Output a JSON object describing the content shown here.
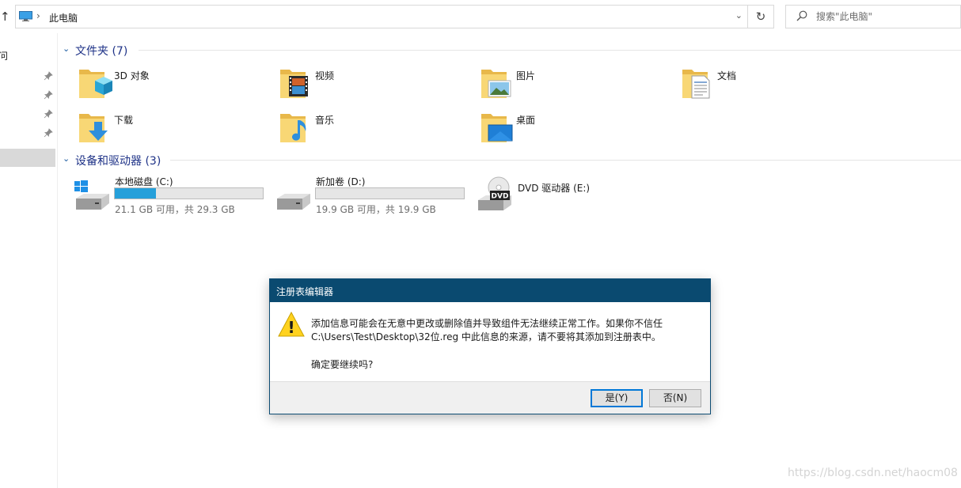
{
  "address_bar": {
    "up_glyph": "↑",
    "separator": "›",
    "location": "此电脑",
    "dropdown_glyph": "⌄",
    "refresh_glyph": "↻"
  },
  "search": {
    "placeholder": "搜索\"此电脑\""
  },
  "nav_pane": {
    "partial_text": "问"
  },
  "folders_group": {
    "label": "文件夹 (7)",
    "items": [
      {
        "label": "3D 对象",
        "icon": "3d-objects-folder-icon"
      },
      {
        "label": "视频",
        "icon": "videos-folder-icon"
      },
      {
        "label": "图片",
        "icon": "pictures-folder-icon"
      },
      {
        "label": "文档",
        "icon": "documents-folder-icon"
      },
      {
        "label": "下载",
        "icon": "downloads-folder-icon"
      },
      {
        "label": "音乐",
        "icon": "music-folder-icon"
      },
      {
        "label": "桌面",
        "icon": "desktop-folder-icon"
      }
    ]
  },
  "devices_group": {
    "label": "设备和驱动器 (3)",
    "drives": [
      {
        "name": "本地磁盘 (C:)",
        "size_text": "21.1 GB 可用，共 29.3 GB",
        "used_fraction": 0.28
      },
      {
        "name": "新加卷 (D:)",
        "size_text": "19.9 GB 可用，共 19.9 GB",
        "used_fraction": 0.0
      },
      {
        "name": "DVD 驱动器 (E:)",
        "dvd_label": "DVD"
      }
    ]
  },
  "dialog": {
    "title": "注册表编辑器",
    "message_line1": "添加信息可能会在无意中更改或删除值并导致组件无法继续正常工作。如果你不信任",
    "message_line2": "C:\\Users\\Test\\Desktop\\32位.reg 中此信息的来源，请不要将其添加到注册表中。",
    "question": "确定要继续吗?",
    "yes_label": "是(Y)",
    "no_label": "否(N)",
    "warning_glyph": "!"
  },
  "watermark": "https://blog.csdn.net/haocm08",
  "colors": {
    "accent": "#0078d7",
    "dialog_title_bg": "#0a4a70",
    "group_header": "#1e3287",
    "drive_bar_fill": "#26a0da",
    "folder_yellow": "#f8d775"
  }
}
